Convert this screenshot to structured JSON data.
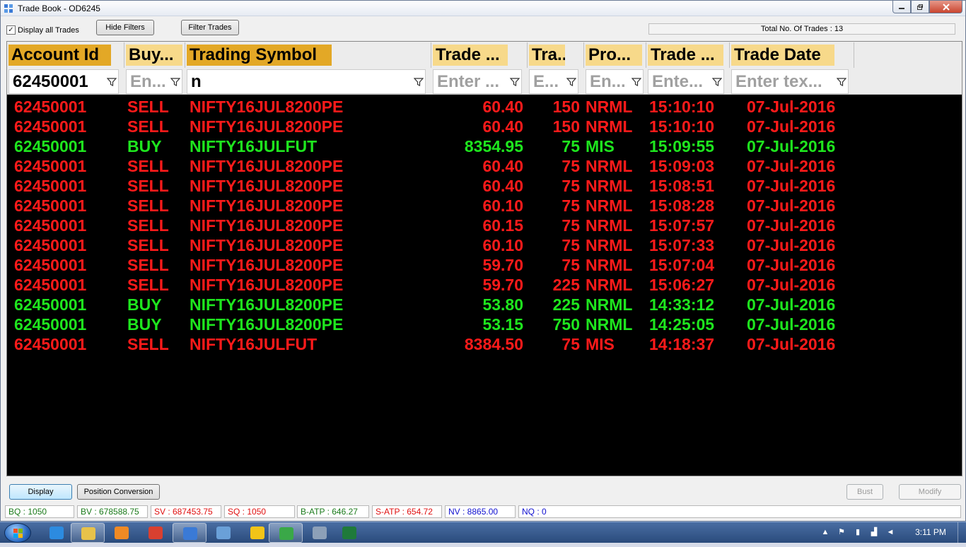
{
  "window": {
    "title": "Trade Book - OD6245"
  },
  "toolbar": {
    "display_all_label": "Display all Trades",
    "display_all_checked": "✓",
    "hide_filters": "Hide Filters",
    "filter_trades": "Filter Trades",
    "total_trades": "Total No. Of Trades : 13"
  },
  "columns": [
    {
      "label": "Account Id",
      "filter": "62450001",
      "is_value": true
    },
    {
      "label": "Buy...",
      "filter": "En...",
      "is_value": false
    },
    {
      "label": "Trading Symbol",
      "filter": "n",
      "is_value": true
    },
    {
      "label": "Trade ...",
      "filter": "Enter ...",
      "is_value": false
    },
    {
      "label": "Tra...",
      "filter": "E...",
      "is_value": false
    },
    {
      "label": "Pro...",
      "filter": "En...",
      "is_value": false
    },
    {
      "label": "Trade ...",
      "filter": "Ente...",
      "is_value": false
    },
    {
      "label": "Trade Date",
      "filter": "Enter tex...",
      "is_value": false
    }
  ],
  "colors": {
    "header_active": "#e3a826",
    "header_inactive": "#f7d98a",
    "sell": "#ff1a1a",
    "buy": "#1ee61e"
  },
  "trades": [
    {
      "account": "62450001",
      "side": "SELL",
      "symbol": "NIFTY16JUL8200PE",
      "price": "60.40",
      "qty": "150",
      "product": "NRML",
      "time": "15:10:10",
      "date": "07-Jul-2016"
    },
    {
      "account": "62450001",
      "side": "SELL",
      "symbol": "NIFTY16JUL8200PE",
      "price": "60.40",
      "qty": "150",
      "product": "NRML",
      "time": "15:10:10",
      "date": "07-Jul-2016"
    },
    {
      "account": "62450001",
      "side": "BUY",
      "symbol": "NIFTY16JULFUT",
      "price": "8354.95",
      "qty": "75",
      "product": "MIS",
      "time": "15:09:55",
      "date": "07-Jul-2016"
    },
    {
      "account": "62450001",
      "side": "SELL",
      "symbol": "NIFTY16JUL8200PE",
      "price": "60.40",
      "qty": "75",
      "product": "NRML",
      "time": "15:09:03",
      "date": "07-Jul-2016"
    },
    {
      "account": "62450001",
      "side": "SELL",
      "symbol": "NIFTY16JUL8200PE",
      "price": "60.40",
      "qty": "75",
      "product": "NRML",
      "time": "15:08:51",
      "date": "07-Jul-2016"
    },
    {
      "account": "62450001",
      "side": "SELL",
      "symbol": "NIFTY16JUL8200PE",
      "price": "60.10",
      "qty": "75",
      "product": "NRML",
      "time": "15:08:28",
      "date": "07-Jul-2016"
    },
    {
      "account": "62450001",
      "side": "SELL",
      "symbol": "NIFTY16JUL8200PE",
      "price": "60.15",
      "qty": "75",
      "product": "NRML",
      "time": "15:07:57",
      "date": "07-Jul-2016"
    },
    {
      "account": "62450001",
      "side": "SELL",
      "symbol": "NIFTY16JUL8200PE",
      "price": "60.10",
      "qty": "75",
      "product": "NRML",
      "time": "15:07:33",
      "date": "07-Jul-2016"
    },
    {
      "account": "62450001",
      "side": "SELL",
      "symbol": "NIFTY16JUL8200PE",
      "price": "59.70",
      "qty": "75",
      "product": "NRML",
      "time": "15:07:04",
      "date": "07-Jul-2016"
    },
    {
      "account": "62450001",
      "side": "SELL",
      "symbol": "NIFTY16JUL8200PE",
      "price": "59.70",
      "qty": "225",
      "product": "NRML",
      "time": "15:06:27",
      "date": "07-Jul-2016"
    },
    {
      "account": "62450001",
      "side": "BUY",
      "symbol": "NIFTY16JUL8200PE",
      "price": "53.80",
      "qty": "225",
      "product": "NRML",
      "time": "14:33:12",
      "date": "07-Jul-2016"
    },
    {
      "account": "62450001",
      "side": "BUY",
      "symbol": "NIFTY16JUL8200PE",
      "price": "53.15",
      "qty": "750",
      "product": "NRML",
      "time": "14:25:05",
      "date": "07-Jul-2016"
    },
    {
      "account": "62450001",
      "side": "SELL",
      "symbol": "NIFTY16JULFUT",
      "price": "8384.50",
      "qty": "75",
      "product": "MIS",
      "time": "14:18:37",
      "date": "07-Jul-2016"
    }
  ],
  "buttons": {
    "display": "Display",
    "position_conversion": "Position Conversion",
    "bust": "Bust",
    "modify": "Modify"
  },
  "status": [
    {
      "text": "BQ : 1050",
      "color": "#1a7a1a"
    },
    {
      "text": "BV : 678588.75",
      "color": "#1a7a1a"
    },
    {
      "text": "SV : 687453.75",
      "color": "#e01010"
    },
    {
      "text": "SQ : 1050",
      "color": "#e01010"
    },
    {
      "text": "B-ATP : 646.27",
      "color": "#1a7a1a"
    },
    {
      "text": "S-ATP : 654.72",
      "color": "#e01010"
    },
    {
      "text": "NV : 8865.00",
      "color": "#1010d0"
    },
    {
      "text": "NQ : 0",
      "color": "#1010d0"
    }
  ],
  "taskbar": {
    "clock": "3:11 PM",
    "items": [
      {
        "name": "ie-icon",
        "color": "#2c8be0",
        "active": false
      },
      {
        "name": "folder-icon",
        "color": "#e8c24a",
        "active": true
      },
      {
        "name": "media-player-icon",
        "color": "#f08a24",
        "active": false
      },
      {
        "name": "chrome-icon",
        "color": "#d94030",
        "active": false
      },
      {
        "name": "trading-app-icon",
        "color": "#3a7ad6",
        "active": true
      },
      {
        "name": "remote-desktop-icon",
        "color": "#6aa0d8",
        "active": false
      },
      {
        "name": "drive-icon",
        "color": "#f2c417",
        "active": false
      },
      {
        "name": "chrome-alt-icon",
        "color": "#3aa848",
        "active": true
      },
      {
        "name": "calculator-icon",
        "color": "#8da0b8",
        "active": false
      },
      {
        "name": "excel-icon",
        "color": "#1f7a3a",
        "active": false
      }
    ]
  }
}
